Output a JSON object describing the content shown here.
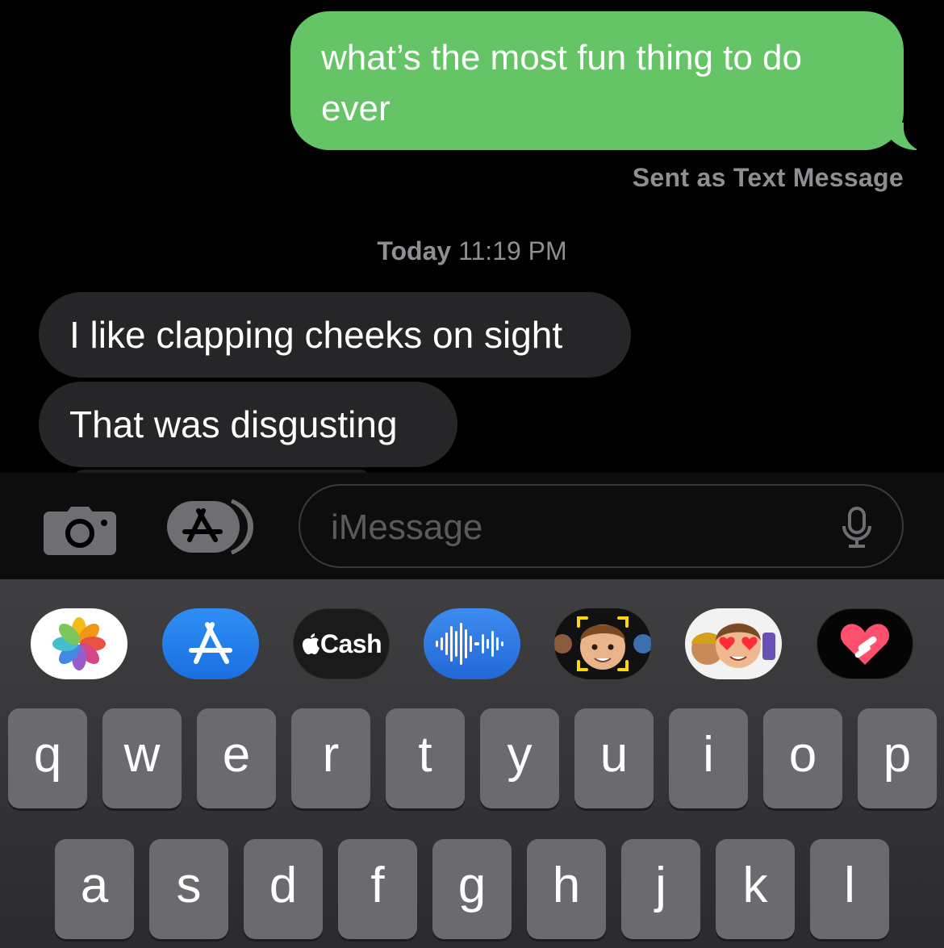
{
  "conversation": {
    "outgoing": [
      "what’s the most fun thing to do ever"
    ],
    "sent_note": "Sent as Text Message",
    "timestamp_day": "Today",
    "timestamp_time": "11:19 PM",
    "incoming": [
      "I like clapping cheeks on sight",
      "That was disgusting"
    ]
  },
  "composer": {
    "placeholder": "iMessage",
    "camera_icon": "camera-icon",
    "apps_icon": "app-store-icon",
    "mic_icon": "microphone-icon"
  },
  "app_drawer": {
    "apps": [
      "photos-icon",
      "app-store-icon",
      "apple-cash-icon",
      "audio-message-icon",
      "memoji-camera-icon",
      "memoji-stickers-icon",
      "digital-touch-icon"
    ],
    "cash_label": "Cash"
  },
  "keyboard": {
    "row1": [
      "q",
      "w",
      "e",
      "r",
      "t",
      "y",
      "u",
      "i",
      "o",
      "p"
    ],
    "row2": [
      "a",
      "s",
      "d",
      "f",
      "g",
      "h",
      "j",
      "k",
      "l"
    ]
  },
  "colors": {
    "outgoing_bubble": "#65c466",
    "incoming_bubble": "#262628",
    "background": "#000000",
    "key": "#6b6b6f"
  }
}
